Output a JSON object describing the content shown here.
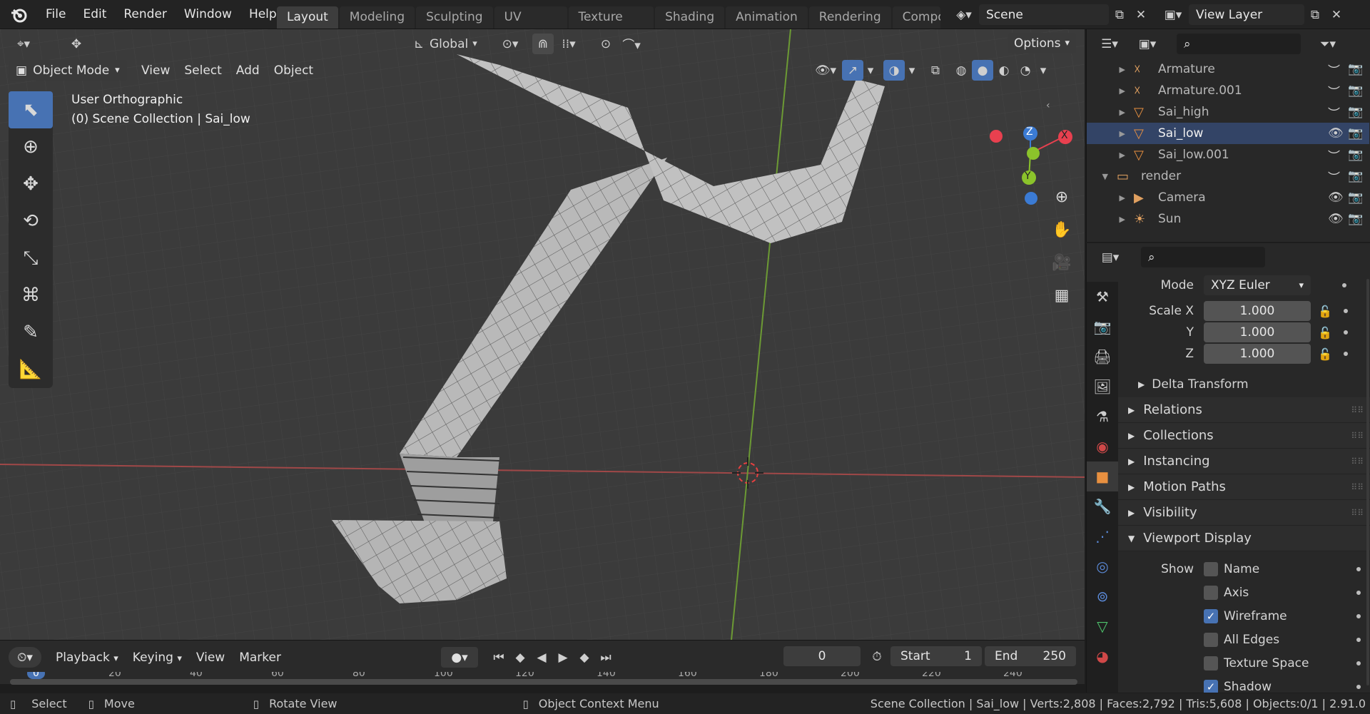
{
  "topbar": {
    "menus": [
      "File",
      "Edit",
      "Render",
      "Window",
      "Help"
    ],
    "workspaces": [
      "Layout",
      "Modeling",
      "Sculpting",
      "UV Editing",
      "Texture Paint",
      "Shading",
      "Animation",
      "Rendering",
      "Compos"
    ],
    "active_workspace": "Layout",
    "scene_name": "Scene",
    "view_layer_name": "View Layer"
  },
  "viewport": {
    "transform_orientation": "Global",
    "options_label": "Options",
    "mode": "Object Mode",
    "menus": [
      "View",
      "Select",
      "Add",
      "Object"
    ],
    "view_name": "User Orthographic",
    "collection_info": "(0) Scene Collection | Sai_low",
    "gizmo_labels": {
      "x": "X",
      "y": "Y",
      "z": "Z"
    },
    "colors": {
      "x_axis": "#e8404f",
      "y_axis": "#8bc32b",
      "z_axis": "#3b7bd4",
      "active_tool": "#4772b3"
    }
  },
  "timeline": {
    "menus": [
      "Playback",
      "Keying",
      "View",
      "Marker"
    ],
    "current_frame": "0",
    "start_label": "Start",
    "start_value": "1",
    "end_label": "End",
    "end_value": "250",
    "ruler": [
      "0",
      "20",
      "40",
      "60",
      "80",
      "100",
      "120",
      "140",
      "160",
      "180",
      "200",
      "220",
      "240"
    ]
  },
  "statusbar": {
    "select": "Select",
    "move": "Move",
    "rotate": "Rotate View",
    "context_menu": "Object Context Menu",
    "stats": "Scene Collection | Sai_low | Verts:2,808 | Faces:2,792 | Tris:5,608 | Objects:0/1 | 2.91.0"
  },
  "outliner": {
    "items": [
      {
        "name": "Armature",
        "icon": "armature-icon"
      },
      {
        "name": "Armature.001",
        "icon": "armature-icon"
      },
      {
        "name": "Sai_high",
        "icon": "mesh-icon"
      },
      {
        "name": "Sai_low",
        "icon": "mesh-icon",
        "active": true
      },
      {
        "name": "Sai_low.001",
        "icon": "mesh-icon"
      },
      {
        "name": "render",
        "icon": "collection-icon"
      },
      {
        "name": "Camera",
        "icon": "camera-icon"
      },
      {
        "name": "Sun",
        "icon": "light-icon"
      }
    ]
  },
  "properties": {
    "mode_label": "Mode",
    "mode_value": "XYZ Euler",
    "scale_x_label": "Scale X",
    "scale_y_label": "Y",
    "scale_z_label": "Z",
    "scale_x": "1.000",
    "scale_y": "1.000",
    "scale_z": "1.000",
    "delta_transform": "Delta Transform",
    "panels": [
      "Relations",
      "Collections",
      "Instancing",
      "Motion Paths",
      "Visibility"
    ],
    "viewport_display": "Viewport Display",
    "show_label": "Show",
    "show_options": [
      {
        "label": "Name",
        "checked": false
      },
      {
        "label": "Axis",
        "checked": false
      },
      {
        "label": "Wireframe",
        "checked": true
      },
      {
        "label": "All Edges",
        "checked": false
      },
      {
        "label": "Texture Space",
        "checked": false
      },
      {
        "label": "Shadow",
        "checked": true
      }
    ]
  }
}
